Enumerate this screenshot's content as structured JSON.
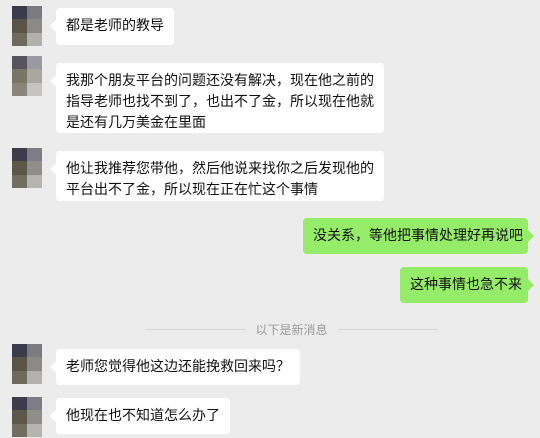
{
  "messages": [
    {
      "side": "left",
      "text": "都是老师的教导"
    },
    {
      "side": "left",
      "lines": [
        "我那个朋友平台的问题还没有解决，现在他之前的",
        "指导老师也找不到了，也出不了金，所以现在他就",
        "是还有几万美金在里面"
      ]
    },
    {
      "side": "left",
      "lines": [
        "他让我推荐您带他，然后他说来找你之后发现他的",
        "平台出不了金，所以现在正在忙这个事情"
      ]
    },
    {
      "side": "right",
      "text": "没关系，等他把事情处理好再说吧"
    },
    {
      "side": "right",
      "text": "这种事情也急不来"
    },
    {
      "side": "left",
      "text": "老师您觉得他这边还能挽救回来吗？"
    },
    {
      "side": "left",
      "text": "他现在也不知道怎么办了"
    }
  ],
  "divider_label": "以下是新消息",
  "colors": {
    "background": "#ececec",
    "incoming_bubble": "#ffffff",
    "outgoing_bubble": "#95ec69",
    "divider_text": "#9a9a9a"
  }
}
